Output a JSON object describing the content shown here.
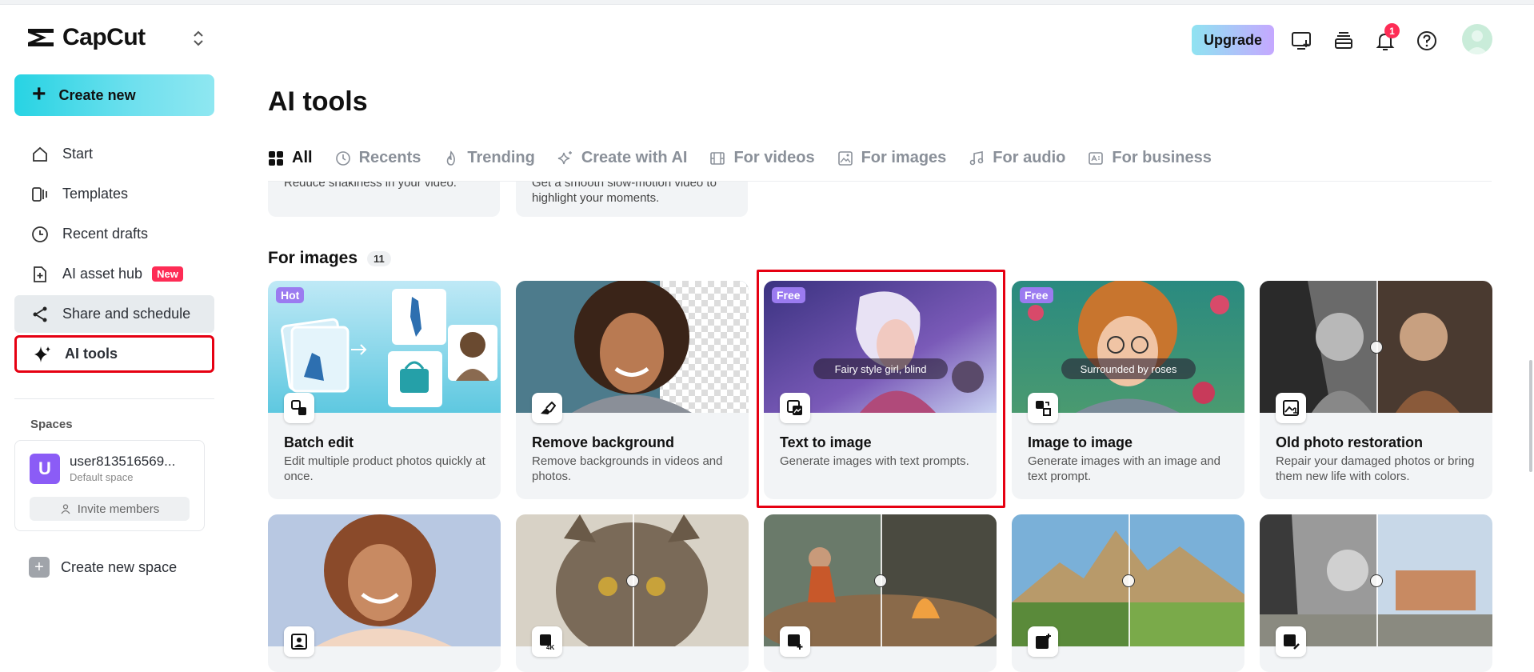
{
  "app": {
    "name": "CapCut"
  },
  "sidebar": {
    "create_label": "Create new",
    "items": [
      {
        "label": "Start",
        "icon": "home-icon"
      },
      {
        "label": "Templates",
        "icon": "templates-icon"
      },
      {
        "label": "Recent drafts",
        "icon": "clock-icon"
      },
      {
        "label": "AI asset hub",
        "icon": "asset-hub-icon",
        "badge": "New"
      },
      {
        "label": "Share and schedule",
        "icon": "share-icon"
      },
      {
        "label": "AI tools",
        "icon": "sparkle-icon"
      }
    ],
    "spaces_label": "Spaces",
    "space": {
      "avatar_letter": "U",
      "name": "user813516569...",
      "subtitle": "Default space",
      "invite_label": "Invite members"
    },
    "new_space_label": "Create new space"
  },
  "header": {
    "upgrade_label": "Upgrade",
    "notification_count": "1",
    "icons": [
      "monitor-download-icon",
      "stack-icon",
      "bell-icon",
      "help-icon"
    ]
  },
  "main": {
    "title": "AI tools",
    "tabs": [
      {
        "label": "All",
        "icon": "grid-icon"
      },
      {
        "label": "Recents",
        "icon": "clock-icon"
      },
      {
        "label": "Trending",
        "icon": "flame-icon"
      },
      {
        "label": "Create with AI",
        "icon": "sparkle-icon"
      },
      {
        "label": "For videos",
        "icon": "film-icon"
      },
      {
        "label": "For images",
        "icon": "image-icon"
      },
      {
        "label": "For audio",
        "icon": "music-icon"
      },
      {
        "label": "For business",
        "icon": "business-icon"
      }
    ],
    "partial_cards": [
      {
        "text_line1": "Reduce shakiness in your video.",
        "text_line2": ""
      },
      {
        "text_line1": "Get a smooth slow-motion video to",
        "text_line2": "highlight your moments."
      }
    ],
    "section": {
      "name": "For images",
      "count": "11",
      "cards": [
        {
          "title": "Batch edit",
          "desc": "Edit multiple product photos quickly at once.",
          "badge": "Hot"
        },
        {
          "title": "Remove background",
          "desc": "Remove backgrounds in videos and photos.",
          "badge": ""
        },
        {
          "title": "Text to image",
          "desc": "Generate images with text prompts.",
          "badge": "Free",
          "prompt": "Fairy style girl, blind"
        },
        {
          "title": "Image to image",
          "desc": "Generate images with an image and text prompt.",
          "badge": "Free",
          "prompt": "Surrounded by roses"
        },
        {
          "title": "Old photo restoration",
          "desc": "Repair your damaged photos or bring them new life with colors.",
          "badge": ""
        }
      ]
    }
  },
  "colors": {
    "accent_cyan": "#27d3e3",
    "badge_red": "#fe2c55",
    "highlight_red": "#e60012",
    "free_purple": "#9b7bf0"
  }
}
